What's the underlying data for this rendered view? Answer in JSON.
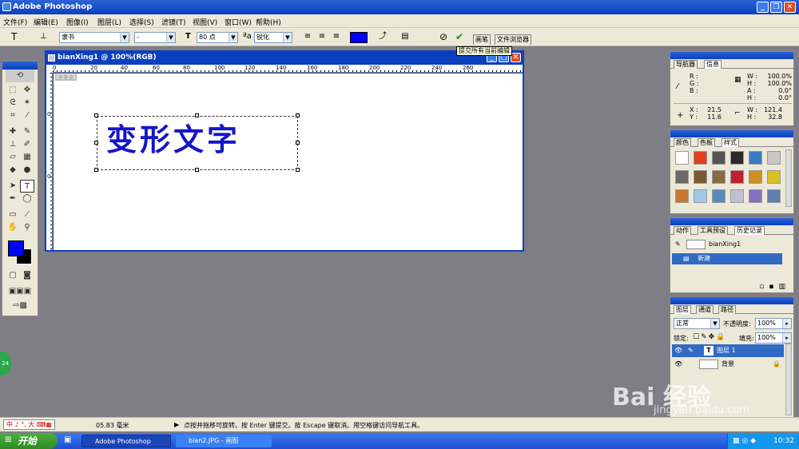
{
  "title_bar": {
    "title": "Adobe Photoshop"
  },
  "menu": [
    "文件(F)",
    "编辑(E)",
    "图像(I)",
    "图层(L)",
    "选择(S)",
    "滤镜(T)",
    "视图(V)",
    "窗口(W)",
    "帮助(H)"
  ],
  "options": {
    "tool_glyph": "T",
    "font_family": "隶书",
    "font_style": "-",
    "font_size": "80 点",
    "antialias": "锐化",
    "color": "#0000ff",
    "tooltip": "提交所有当前编辑",
    "palette_tabs": [
      "画笔",
      "文件浏览器"
    ]
  },
  "document": {
    "title": "bianXing1 @ 100%(RGB)",
    "text": "变形文字",
    "ruler_labels": [
      "0",
      "20",
      "40",
      "60",
      "80",
      "100",
      "120",
      "140",
      "160",
      "180",
      "200",
      "220",
      "240",
      "260"
    ],
    "ruler_corner": "0 1 2 3"
  },
  "info_panel": {
    "tabs": [
      "导航器",
      "信息"
    ],
    "rgb_labels": [
      "R :",
      "G :",
      "B :"
    ],
    "whk": [
      {
        "k": "W :",
        "v": "100.0%"
      },
      {
        "k": "H :",
        "v": "100.0%"
      },
      {
        "k": "A :",
        "v": "0.0°"
      },
      {
        "k": "H :",
        "v": "0.0°"
      }
    ],
    "x_label": "X :",
    "x_value": "21.5",
    "y_label": "Y :",
    "y_value": "11.6",
    "w_label": "W :",
    "w_value": "121.4",
    "h_label": "H :",
    "h_value": "32.8"
  },
  "styles_panel": {
    "tabs": [
      "颜色",
      "色板",
      "样式"
    ],
    "swatch_colors": [
      "#ffffff",
      "#e0401a",
      "#555555",
      "#2a2a2a",
      "#3a7ac8",
      "#c8c8c8",
      "#6a6a6a",
      "#7a5a30",
      "#8a6a40",
      "#c02030",
      "#d09020",
      "#d8c020",
      "#c87830",
      "#a0c8e8",
      "#5a8ab8",
      "#c0c0d0",
      "#8070c0",
      "#6080b0"
    ]
  },
  "history_panel": {
    "tabs": [
      "动作",
      "工具预设",
      "历史记录"
    ],
    "snapshot": "bianXing1",
    "state": "新建"
  },
  "layers_panel": {
    "tabs": [
      "图层",
      "通道",
      "路径"
    ],
    "blend_mode": "正常",
    "opacity_label": "不透明度:",
    "opacity": "100%",
    "lock_label": "锁定:",
    "fill_label": "填充:",
    "fill": "100%",
    "layers": [
      {
        "name": "图层 1",
        "type": "T"
      },
      {
        "name": "背景"
      }
    ]
  },
  "status": {
    "zoom": "05.83 毫米",
    "hint": "点按并拖移可旋转。按 Enter 键提交。按 Escape 键取消。用空格键访问导航工具。",
    "ime": "中 ♪ °, 大",
    "badge": "24"
  },
  "watermark": {
    "line1": "Bai 经验",
    "line2": "jingyan.baidu.com"
  },
  "taskbar": {
    "start": "开始",
    "tasks": [
      "Adobe Photoshop",
      "bian2.JPG - 画图"
    ],
    "time": "10:32"
  }
}
